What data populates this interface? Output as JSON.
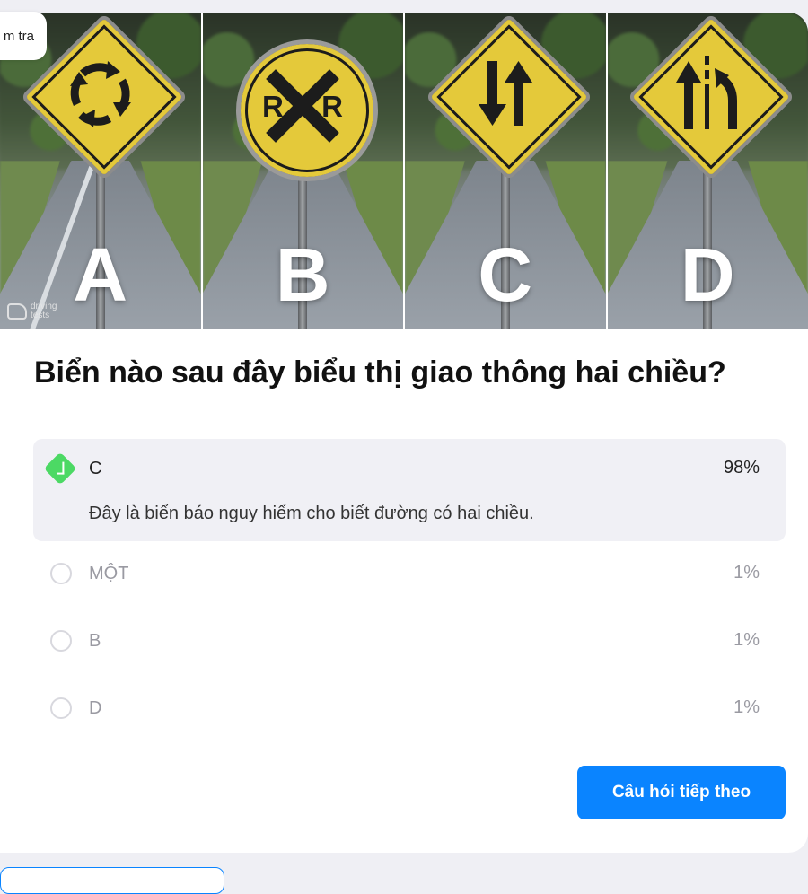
{
  "tab": {
    "label": "m tra"
  },
  "image": {
    "watermark": "driving tests",
    "panels": [
      {
        "letter": "A",
        "sign": "roundabout-sign-icon"
      },
      {
        "letter": "B",
        "sign": "railroad-crossing-sign-icon"
      },
      {
        "letter": "C",
        "sign": "two-way-traffic-sign-icon"
      },
      {
        "letter": "D",
        "sign": "lane-merge-sign-icon"
      }
    ]
  },
  "question": "Biển nào sau đây biểu thị giao thông hai chiều?",
  "answers": {
    "selected": {
      "label": "C",
      "percent": "98%",
      "explanation": "Đây là biển báo nguy hiểm cho biết đường có hai chiều."
    },
    "others": [
      {
        "label": "MỘT",
        "percent": "1%"
      },
      {
        "label": "B",
        "percent": "1%"
      },
      {
        "label": "D",
        "percent": "1%"
      }
    ]
  },
  "next_button": {
    "label": "Câu hỏi tiếp theo"
  },
  "colors": {
    "accent": "#0a84ff",
    "correct": "#4cd964",
    "sign_yellow": "#e4c93a"
  }
}
